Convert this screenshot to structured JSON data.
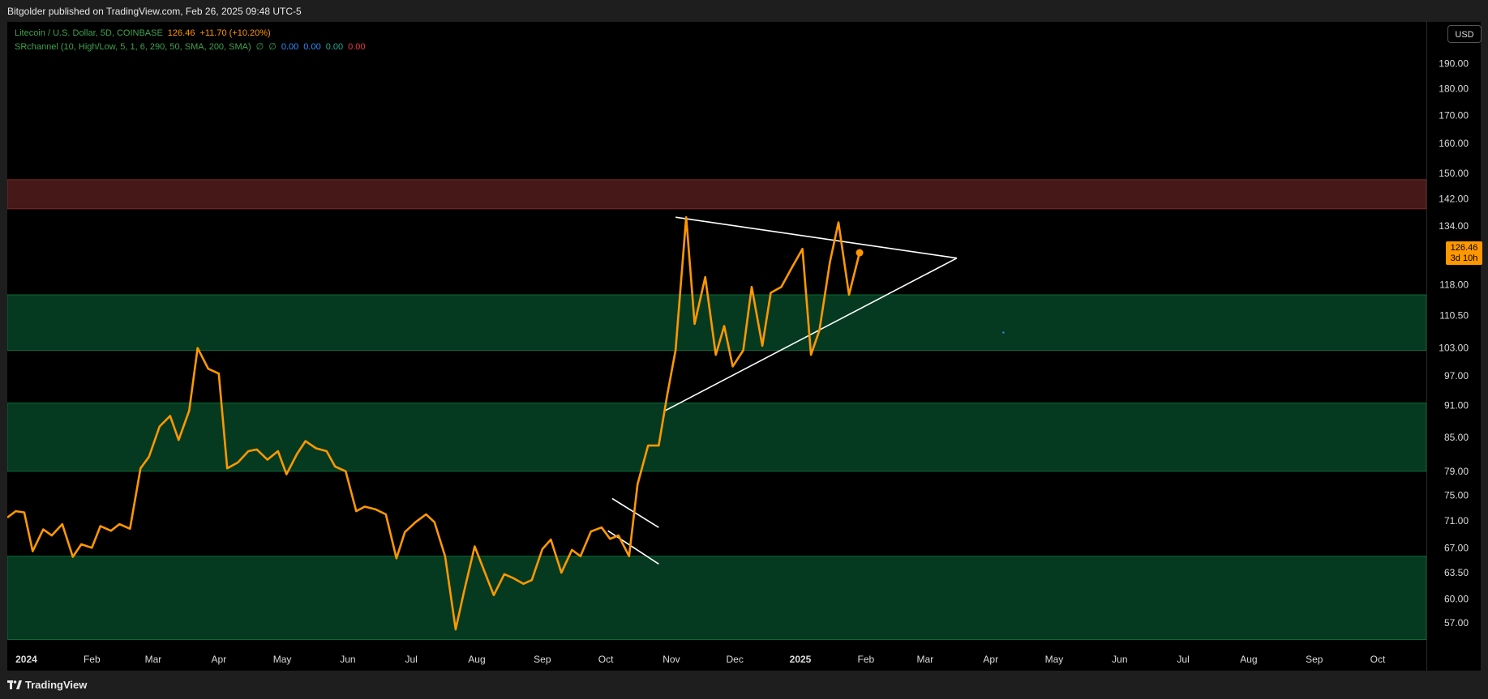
{
  "header": {
    "publish_line": "Bitgolder published on TradingView.com, Feb 26, 2025 09:48 UTC-5"
  },
  "legend": {
    "symbol": "Litecoin / U.S. Dollar, 5D, COINBASE",
    "price": "126.46",
    "change": "+11.70 (+10.20%)",
    "indicator": "SRchannel (10, High/Low, 5, 1, 6, 290, 50, SMA, 200, SMA)",
    "na1": "∅",
    "na2": "∅",
    "v1": "0.00",
    "v2": "0.00",
    "v3": "0.00",
    "v4": "0.00"
  },
  "currency_button": "USD",
  "price_badge": {
    "price": "126.46",
    "countdown": "3d 10h"
  },
  "footer": {
    "brand": "TradingView"
  },
  "colors": {
    "line": "#ff9800",
    "support_zone": "#053a20",
    "resistance_zone": "#461818",
    "trendline": "#ffffff",
    "axis_text": "#dcdcdc",
    "background": "#000000"
  },
  "chart_data": {
    "type": "line",
    "title": "Litecoin / U.S. Dollar, 5D, COINBASE",
    "y_scale": "log",
    "ylim": [
      54,
      205
    ],
    "y_ticks": [
      190.0,
      180.0,
      170.0,
      160.0,
      150.0,
      142.0,
      134.0,
      118.0,
      110.5,
      103.0,
      97.0,
      91.0,
      85.0,
      79.0,
      75.0,
      71.0,
      67.0,
      63.5,
      60.0,
      57.0
    ],
    "y_tick_labels": [
      "190.00",
      "180.00",
      "170.00",
      "160.00",
      "150.00",
      "142.00",
      "134.00",
      "118.00",
      "110.50",
      "103.00",
      "97.00",
      "91.00",
      "85.00",
      "79.00",
      "75.00",
      "71.00",
      "67.00",
      "63.50",
      "60.00",
      "57.00"
    ],
    "x_range": [
      "2023-12-23",
      "2025-10-24"
    ],
    "x_ticks": [
      {
        "date": "2024-01-01",
        "label": "2024",
        "bold": true
      },
      {
        "date": "2024-02-01",
        "label": "Feb"
      },
      {
        "date": "2024-03-01",
        "label": "Mar"
      },
      {
        "date": "2024-04-01",
        "label": "Apr"
      },
      {
        "date": "2024-05-01",
        "label": "May"
      },
      {
        "date": "2024-06-01",
        "label": "Jun"
      },
      {
        "date": "2024-07-01",
        "label": "Jul"
      },
      {
        "date": "2024-08-01",
        "label": "Aug"
      },
      {
        "date": "2024-09-01",
        "label": "Sep"
      },
      {
        "date": "2024-10-01",
        "label": "Oct"
      },
      {
        "date": "2024-11-01",
        "label": "Nov"
      },
      {
        "date": "2024-12-01",
        "label": "Dec"
      },
      {
        "date": "2025-01-01",
        "label": "2025",
        "bold": true
      },
      {
        "date": "2025-02-01",
        "label": "Feb"
      },
      {
        "date": "2025-03-01",
        "label": "Mar"
      },
      {
        "date": "2025-04-01",
        "label": "Apr"
      },
      {
        "date": "2025-05-01",
        "label": "May"
      },
      {
        "date": "2025-06-01",
        "label": "Jun"
      },
      {
        "date": "2025-07-01",
        "label": "Jul"
      },
      {
        "date": "2025-08-01",
        "label": "Aug"
      },
      {
        "date": "2025-09-01",
        "label": "Sep"
      },
      {
        "date": "2025-10-01",
        "label": "Oct"
      }
    ],
    "series": [
      {
        "values": [
          [
            "2023-12-23",
            71.5
          ],
          [
            "2023-12-27",
            72.5
          ],
          [
            "2023-12-31",
            72.3
          ],
          [
            "2024-01-04",
            66.5
          ],
          [
            "2024-01-09",
            69.7
          ],
          [
            "2024-01-13",
            68.8
          ],
          [
            "2024-01-18",
            70.5
          ],
          [
            "2024-01-23",
            65.7
          ],
          [
            "2024-01-27",
            67.5
          ],
          [
            "2024-02-01",
            67.0
          ],
          [
            "2024-02-05",
            70.2
          ],
          [
            "2024-02-10",
            69.5
          ],
          [
            "2024-02-14",
            70.5
          ],
          [
            "2024-02-19",
            69.8
          ],
          [
            "2024-02-24",
            79.5
          ],
          [
            "2024-02-28",
            81.5
          ],
          [
            "2024-03-04",
            87.0
          ],
          [
            "2024-03-09",
            89.0
          ],
          [
            "2024-03-13",
            84.5
          ],
          [
            "2024-03-18",
            90.0
          ],
          [
            "2024-03-22",
            103.0
          ],
          [
            "2024-03-27",
            98.5
          ],
          [
            "2024-04-01",
            97.5
          ],
          [
            "2024-04-05",
            79.5
          ],
          [
            "2024-04-10",
            80.5
          ],
          [
            "2024-04-15",
            82.5
          ],
          [
            "2024-04-19",
            82.8
          ],
          [
            "2024-04-24",
            81.0
          ],
          [
            "2024-04-29",
            82.5
          ],
          [
            "2024-05-03",
            78.5
          ],
          [
            "2024-05-08",
            82.0
          ],
          [
            "2024-05-12",
            84.3
          ],
          [
            "2024-05-17",
            83.0
          ],
          [
            "2024-05-22",
            82.5
          ],
          [
            "2024-05-26",
            79.8
          ],
          [
            "2024-05-31",
            79.0
          ],
          [
            "2024-06-05",
            72.5
          ],
          [
            "2024-06-09",
            73.2
          ],
          [
            "2024-06-14",
            72.8
          ],
          [
            "2024-06-19",
            72.0
          ],
          [
            "2024-06-24",
            65.5
          ],
          [
            "2024-06-28",
            69.3
          ],
          [
            "2024-07-03",
            70.8
          ],
          [
            "2024-07-08",
            72.0
          ],
          [
            "2024-07-12",
            70.8
          ],
          [
            "2024-07-17",
            65.8
          ],
          [
            "2024-07-22",
            56.2
          ],
          [
            "2024-07-26",
            61.0
          ],
          [
            "2024-07-31",
            67.2
          ],
          [
            "2024-08-05",
            63.4
          ],
          [
            "2024-08-09",
            60.5
          ],
          [
            "2024-08-14",
            63.3
          ],
          [
            "2024-08-18",
            62.8
          ],
          [
            "2024-08-23",
            62.0
          ],
          [
            "2024-08-27",
            62.5
          ],
          [
            "2024-09-01",
            66.8
          ],
          [
            "2024-09-05",
            68.2
          ],
          [
            "2024-09-10",
            63.5
          ],
          [
            "2024-09-15",
            66.7
          ],
          [
            "2024-09-19",
            65.8
          ],
          [
            "2024-09-24",
            69.4
          ],
          [
            "2024-09-29",
            70.0
          ],
          [
            "2024-10-03",
            68.3
          ],
          [
            "2024-10-07",
            68.8
          ],
          [
            "2024-10-12",
            65.8
          ],
          [
            "2024-10-16",
            76.8
          ],
          [
            "2024-10-21",
            83.5
          ],
          [
            "2024-10-26",
            83.5
          ],
          [
            "2024-10-30",
            93.0
          ],
          [
            "2024-11-03",
            102.5
          ],
          [
            "2024-11-08",
            136.5
          ],
          [
            "2024-11-12",
            108.5
          ],
          [
            "2024-11-17",
            120.0
          ],
          [
            "2024-11-22",
            101.5
          ],
          [
            "2024-11-26",
            108.0
          ],
          [
            "2024-11-30",
            99.0
          ],
          [
            "2024-12-05",
            102.5
          ],
          [
            "2024-12-09",
            117.5
          ],
          [
            "2024-12-14",
            103.5
          ],
          [
            "2024-12-18",
            116.0
          ],
          [
            "2024-12-23",
            117.5
          ],
          [
            "2024-12-28",
            122.5
          ],
          [
            "2025-01-02",
            127.5
          ],
          [
            "2025-01-06",
            101.5
          ],
          [
            "2025-01-10",
            107.0
          ],
          [
            "2025-01-15",
            124.0
          ],
          [
            "2025-01-19",
            135.0
          ],
          [
            "2025-01-24",
            115.5
          ],
          [
            "2025-01-29",
            126.46
          ]
        ]
      }
    ],
    "zones": [
      {
        "kind": "resistance",
        "from": 139.0,
        "to": 148.0
      },
      {
        "kind": "support",
        "from": 102.5,
        "to": 115.5
      },
      {
        "kind": "support",
        "from": 79.0,
        "to": 91.5
      },
      {
        "kind": "support",
        "from": 55.0,
        "to": 65.8
      }
    ],
    "trendlines": [
      {
        "from": [
          "2024-11-03",
          136.5
        ],
        "to": [
          "2025-03-16",
          125.0
        ]
      },
      {
        "from": [
          "2024-10-29",
          90.0
        ],
        "to": [
          "2025-03-16",
          125.0
        ]
      },
      {
        "from": [
          "2024-10-04",
          74.5
        ],
        "to": [
          "2024-10-26",
          70.0
        ]
      },
      {
        "from": [
          "2024-10-02",
          69.5
        ],
        "to": [
          "2024-10-26",
          64.7
        ]
      }
    ],
    "last_point": [
      "2025-01-29",
      126.46
    ]
  }
}
